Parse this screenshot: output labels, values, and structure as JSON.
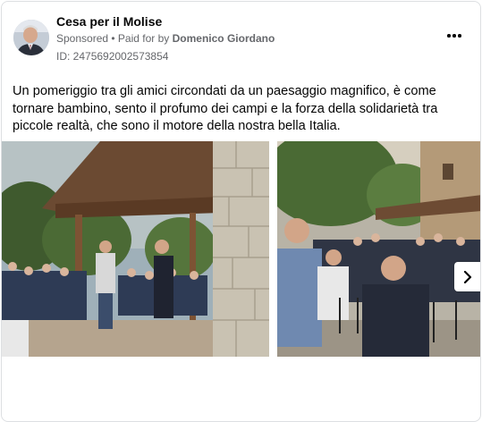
{
  "post": {
    "page_name": "Cesa per il Molise",
    "sponsored_label": "Sponsored",
    "separator": " • ",
    "paid_by_label": "Paid for by ",
    "payer": "Domenico Giordano",
    "ad_id": "ID: 2475692002573854",
    "message": "Un pomeriggio tra gli amici circondati da un paesaggio magnifico, è come tornare bambino, sento il profumo dei campi e la forza della solidarietà tra piccole realtà, che sono il motore della nostra bella Italia."
  },
  "icons": {
    "more": "more-horizontal-icon",
    "next": "chevron-right-icon"
  },
  "colors": {
    "text": "#050505",
    "secondary_text": "#65676b",
    "border": "#dddfe2"
  }
}
